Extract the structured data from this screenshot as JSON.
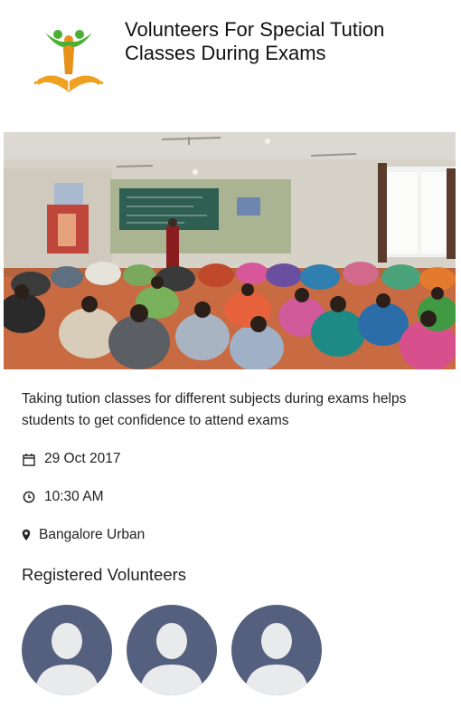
{
  "event": {
    "title": "Volunteers For Special Tution Classes During Exams",
    "description": "Taking tution classes for different subjects during exams helps students to get confidence to attend exams",
    "date": "29 Oct 2017",
    "time": "10:30 AM",
    "location": "Bangalore Urban"
  },
  "icons": {
    "date": "calendar-icon",
    "time": "clock-icon",
    "location": "map-pin-icon"
  },
  "volunteers": {
    "heading": "Registered Volunteers",
    "count": 3
  },
  "colors": {
    "logo_green": "#4caf35",
    "logo_orange": "#f0a020",
    "avatar_bg": "#54607d",
    "avatar_fg": "#e9eaec"
  }
}
